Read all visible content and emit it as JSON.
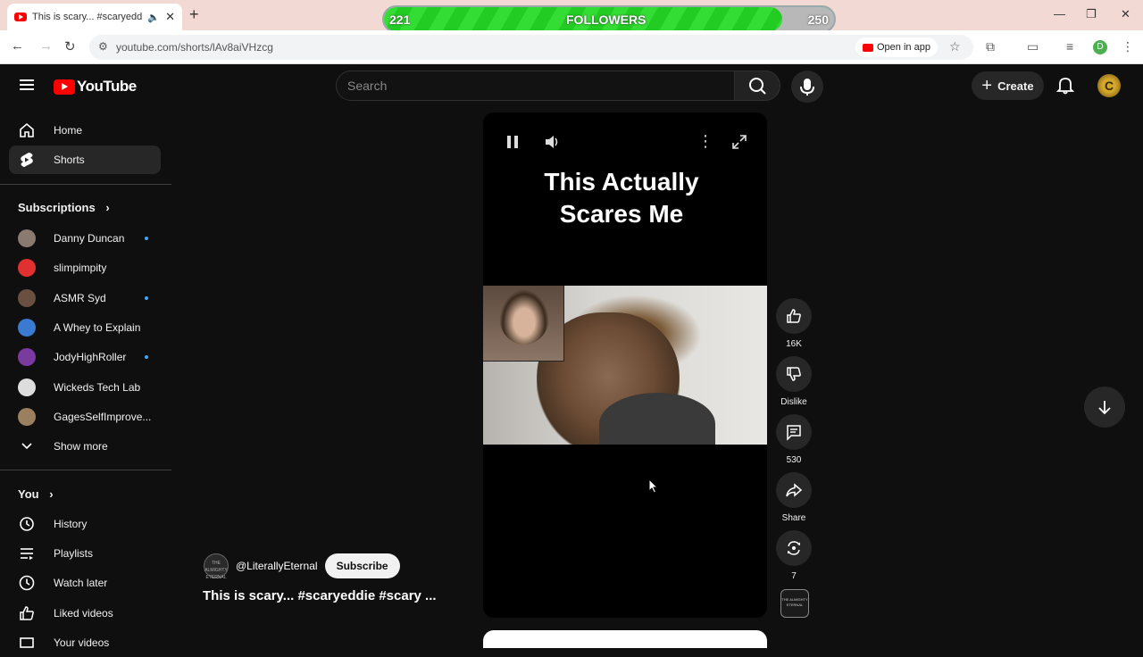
{
  "browser": {
    "tab_title": "This is scary... #scaryeddie #",
    "url": "youtube.com/shorts/lAv8aiVHzcg",
    "open_in_app": "Open in app",
    "profile_initial": "D"
  },
  "followers_bar": {
    "label": "FOLLOWERS",
    "current": "221",
    "goal": "250",
    "progress_fraction": 0.884,
    "color": "#2ed12e"
  },
  "header": {
    "logo_text": "YouTube",
    "search_placeholder": "Search",
    "create_label": "Create",
    "avatar_letter": "C"
  },
  "sidebar": {
    "home": "Home",
    "shorts": "Shorts",
    "subscriptions_title": "Subscriptions",
    "subscriptions": [
      {
        "name": "Danny Duncan",
        "new": true,
        "color": "#8a7a70"
      },
      {
        "name": "slimpimpity",
        "new": false,
        "color": "#e03030"
      },
      {
        "name": "ASMR Syd",
        "new": true,
        "color": "#6a5040"
      },
      {
        "name": "A Whey to Explain",
        "new": false,
        "color": "#3a7ad0"
      },
      {
        "name": "JodyHighRoller",
        "new": true,
        "color": "#7a3aa0"
      },
      {
        "name": "Wickeds Tech Lab",
        "new": false,
        "color": "#dddddd"
      },
      {
        "name": "GagesSelfImprove...",
        "new": false,
        "color": "#9a8060"
      }
    ],
    "show_more": "Show more",
    "you_title": "You",
    "you_items": [
      "History",
      "Playlists",
      "Watch later",
      "Liked videos",
      "Your videos"
    ]
  },
  "short": {
    "headline_line1": "This Actually",
    "headline_line2": "Scares Me",
    "channel_handle": "@LiterallyEternal",
    "channel_avatar_text": "THE ALMIGHTY ETERNAL",
    "subscribe_label": "Subscribe",
    "title": "This is scary... #scaryeddie #scary ..."
  },
  "actions": {
    "likes": "16K",
    "dislike_label": "Dislike",
    "comments": "530",
    "share_label": "Share",
    "remix_count": "7",
    "sound_thumb_text": "THE ALMIGHTY ETERNAL"
  }
}
